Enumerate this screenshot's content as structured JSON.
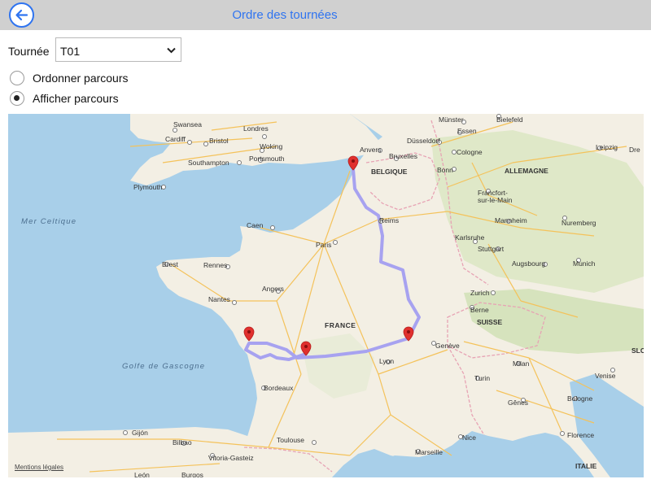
{
  "header": {
    "title": "Ordre des tournées",
    "back_icon": "back-arrow-icon"
  },
  "tournee": {
    "label": "Tournée",
    "selected": "T01"
  },
  "options": [
    {
      "label": "Ordonner parcours",
      "checked": false
    },
    {
      "label": "Afficher parcours",
      "checked": true
    }
  ],
  "map": {
    "credit": "Mentions légales",
    "route_color": "#a7a2f0",
    "marker_color": "#e0302e",
    "labels": {
      "swansea": "Swansea",
      "cardiff": "Cardiff",
      "bristol": "Bristol",
      "londres": "Londres",
      "woking": "Woking",
      "southampton": "Southampton",
      "portsmouth": "Portsmouth",
      "plymouth": "Plymouth",
      "mer_celtique": "Mer Celtique",
      "caen": "Caen",
      "brest": "Brest",
      "rennes": "Rennes",
      "nantes": "Nantes",
      "angers": "Angers",
      "paris": "Paris",
      "reims": "Reims",
      "golfe": "Golfe de Gascogne",
      "bordeaux": "Bordeaux",
      "toulouse": "Toulouse",
      "france": "FRANCE",
      "lyon": "Lyon",
      "geneve": "Genève",
      "anvers": "Anvers",
      "bruxelles": "Bruxelles",
      "belgique": "BELGIQUE",
      "munster": "Münster",
      "bielefeld": "Bielefeld",
      "essen": "Essen",
      "dusseldorf": "Düsseldorf",
      "cologne": "Cologne",
      "bonn": "Bonn",
      "allemagne": "ALLEMAGNE",
      "leipzig": "Leipzig",
      "francfort": "Francfort-\nsur-le-Main",
      "mannheim": "Mannheim",
      "nuremberg": "Nuremberg",
      "karlsruhe": "Karlsruhe",
      "stuttgart": "Stuttgart",
      "augsbourg": "Augsbourg",
      "munich": "Munich",
      "zurich": "Zurich",
      "berne": "Berne",
      "suisse": "SUISSE",
      "milan": "Milan",
      "venise": "Venise",
      "turin": "Turin",
      "genes": "Gênes",
      "bologne": "Bologne",
      "florence": "Florence",
      "nice": "Nice",
      "marseille": "Marseille",
      "italie": "ITALIE",
      "gijon": "Gijón",
      "bilbao": "Bilbao",
      "vitoria": "Vitoria-Gasteiz",
      "leon": "León",
      "burgos": "Burgos",
      "slo": "SLO",
      "dre": "Dre"
    }
  }
}
